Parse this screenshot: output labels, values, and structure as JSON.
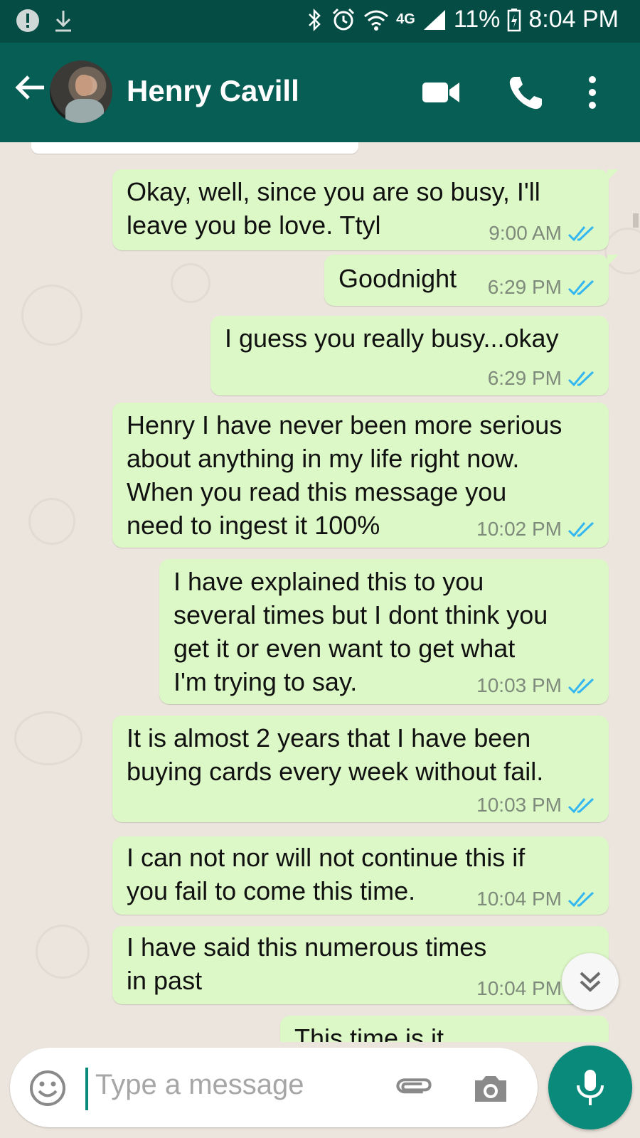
{
  "status_bar": {
    "network": "4G",
    "battery": "11%",
    "time": "8:04 PM"
  },
  "header": {
    "contact_name": "Henry Cavill",
    "icons": [
      "back-arrow-icon",
      "video-call-icon",
      "phone-icon",
      "more-options-icon"
    ]
  },
  "messages": [
    {
      "text": "Okay, well, since you are so busy, I'll\nleave you be love. Ttyl",
      "time": "9:00 AM",
      "status": "read"
    },
    {
      "text": "Goodnight",
      "time": "6:29 PM",
      "status": "read"
    },
    {
      "text": "I guess you really busy...okay",
      "time": "6:29 PM",
      "status": "read"
    },
    {
      "text": "Henry I have never been more serious\nabout anything in my life right now.\nWhen you read this message you\nneed to ingest it 100%",
      "time": "10:02 PM",
      "status": "read"
    },
    {
      "text": "I have explained this to you\nseveral times but I dont think you\nget it or even want to get what\nI'm trying to say.",
      "time": "10:03 PM",
      "status": "read"
    },
    {
      "text": "It is almost 2 years that I have been\nbuying cards every week without fail.",
      "time": "10:03 PM",
      "status": "read"
    },
    {
      "text": "I can not nor will not continue this if\nyou fail to come this time.",
      "time": "10:04 PM",
      "status": "read"
    },
    {
      "text": "I have said this numerous times\nin past",
      "time": "10:04 PM",
      "status": "read"
    },
    {
      "text": "This time is it",
      "time": "",
      "status": "read"
    }
  ],
  "input": {
    "placeholder": "Type a message"
  },
  "colors": {
    "header": "#075e54",
    "status_bar": "#054d44",
    "outgoing_bubble": "#dcf8c6",
    "read_ticks": "#34b7f1",
    "accent": "#0a8a7a"
  }
}
